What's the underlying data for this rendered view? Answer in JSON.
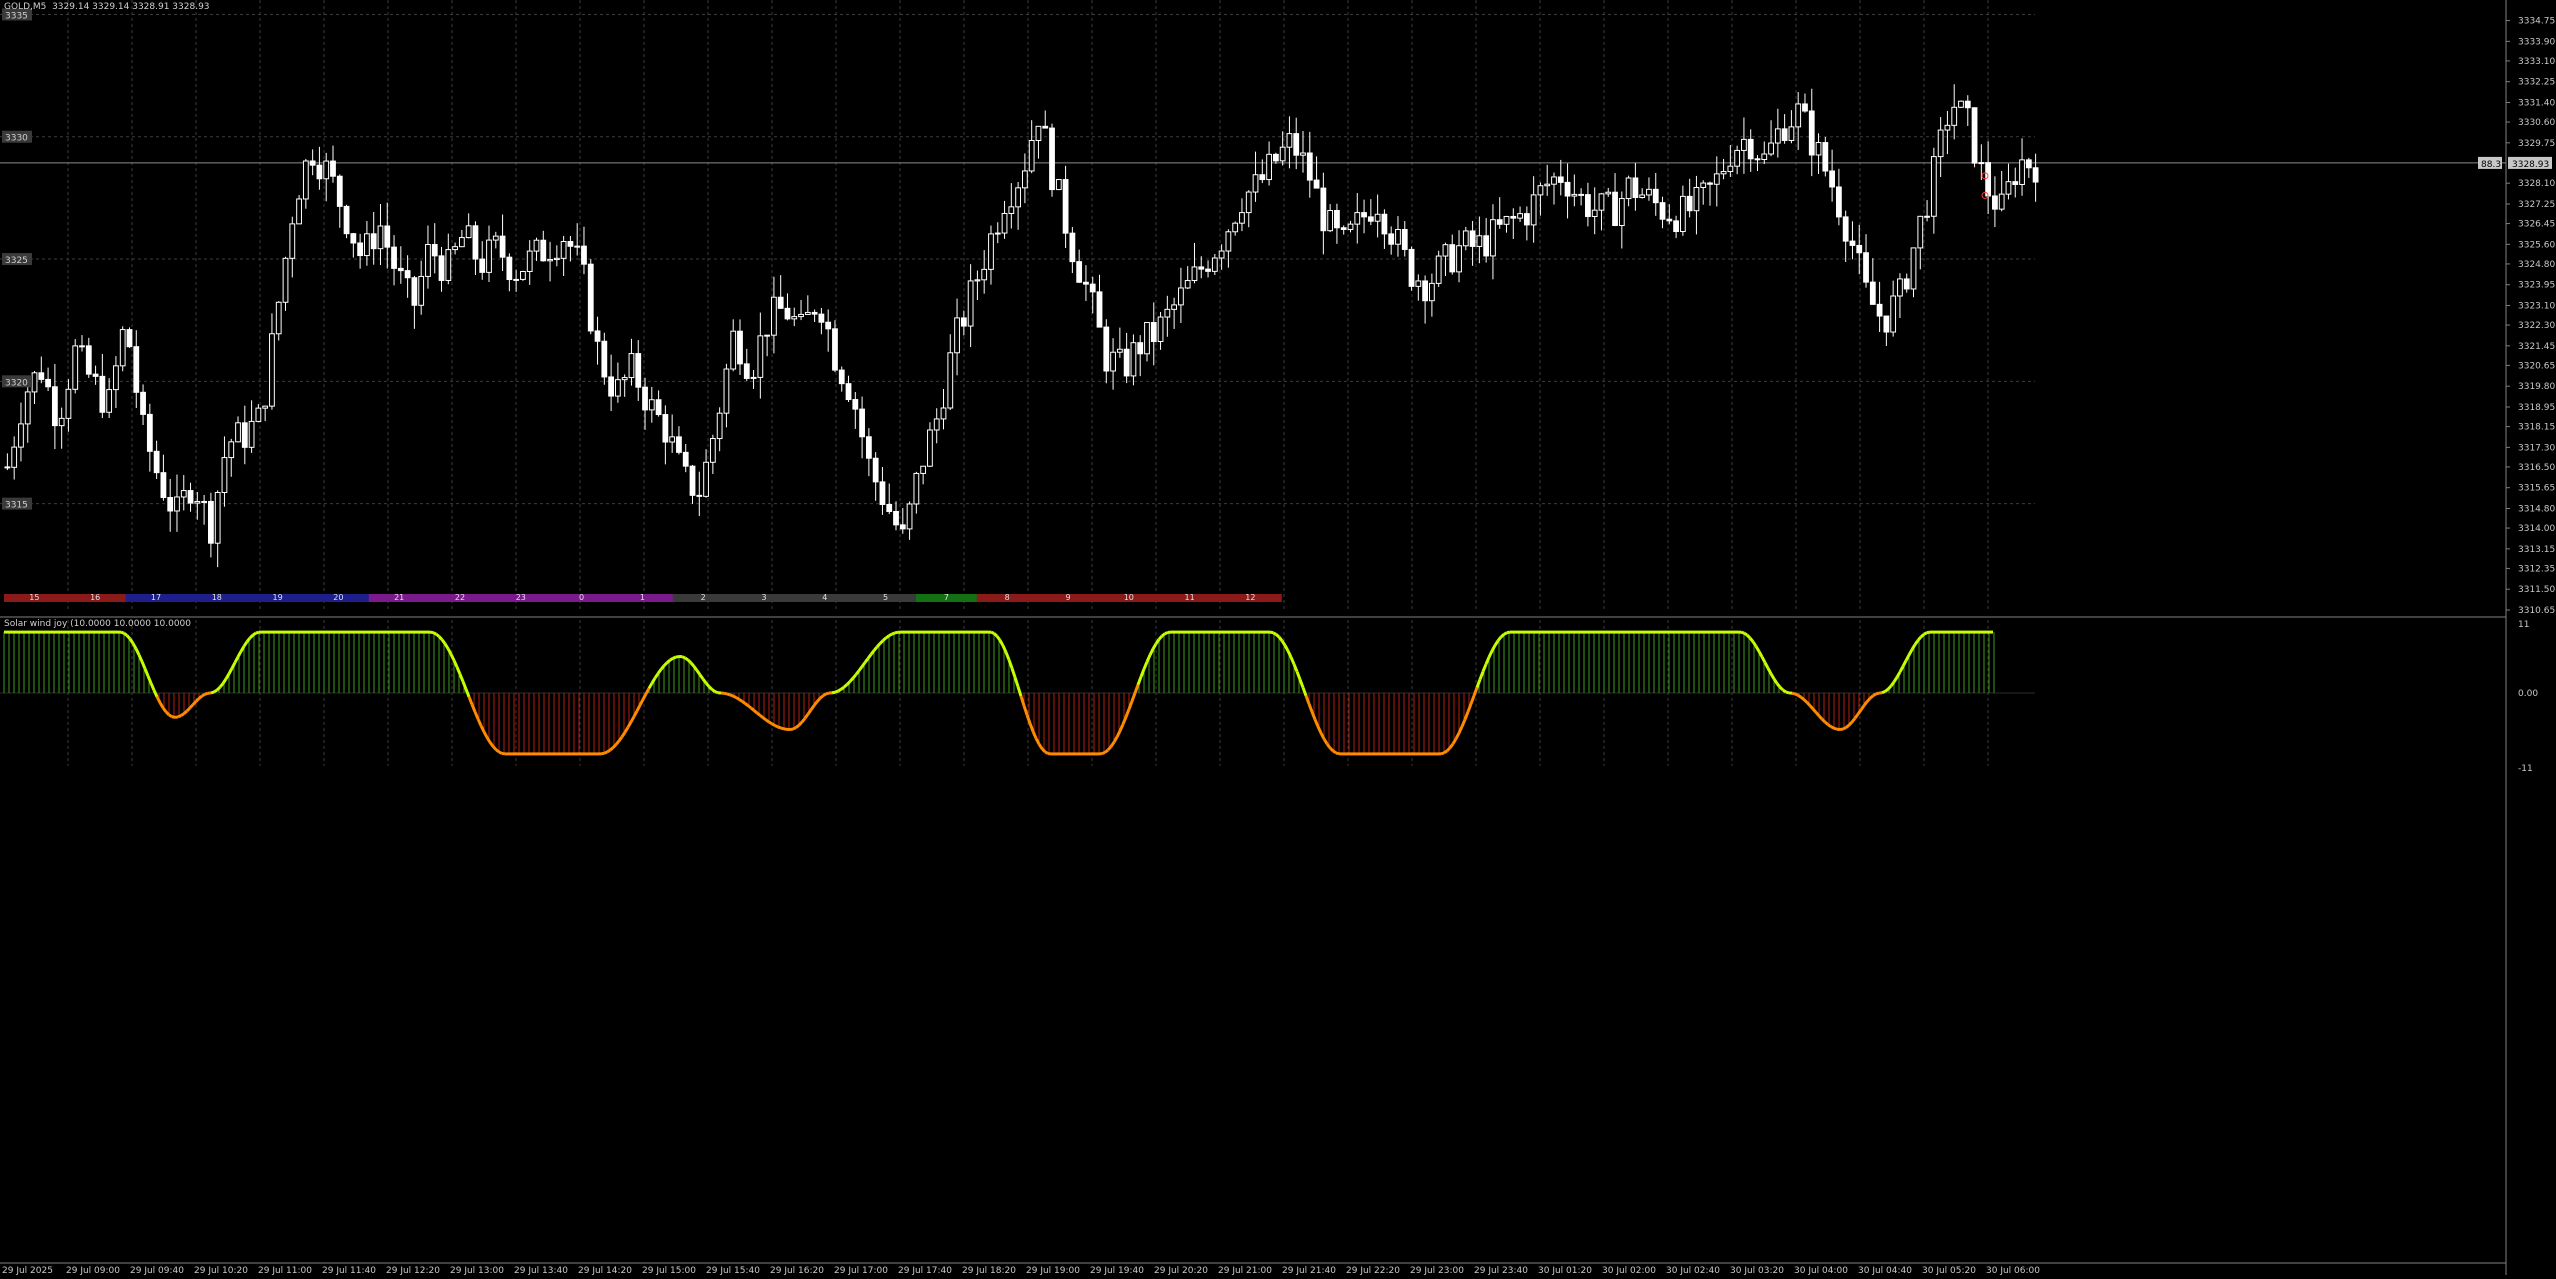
{
  "header": {
    "symbol_line": "GOLD,M5  3329.14 3329.14 3328.91 3328.93",
    "indicator_line": "Solar wind joy (10.0000 10.0000 10.0000"
  },
  "colors": {
    "background": "#000000",
    "grid": "#3c3c3c",
    "candle": "#ffffff",
    "bid_line": "#8c8c8c",
    "osc_pos": "#3a9a1e",
    "osc_neg": "#b22010",
    "osc_line_pos": "#c8ff00",
    "osc_line_neg": "#ff8c00"
  },
  "price_axis": {
    "ticks": [
      "3334.75",
      "3333.90",
      "3333.10",
      "3332.25",
      "3331.40",
      "3330.60",
      "3329.75",
      "3328.10",
      "3327.25",
      "3326.45",
      "3325.60",
      "3324.80",
      "3323.95",
      "3323.10",
      "3322.30",
      "3321.45",
      "3320.65",
      "3319.80",
      "3318.95",
      "3318.15",
      "3317.30",
      "3316.50",
      "3315.65",
      "3314.80",
      "3314.00",
      "3313.15",
      "3312.35",
      "3311.50",
      "3310.65"
    ],
    "bid_label": "3328.93",
    "bid_left_tag": "88.3"
  },
  "left_labels": [
    "3335",
    "3330",
    "3325",
    "3320",
    "3315"
  ],
  "session_bar": [
    {
      "label": "15",
      "color": "#8b1a1a"
    },
    {
      "label": "16",
      "color": "#8b1a1a"
    },
    {
      "label": "17",
      "color": "#1e1e8c"
    },
    {
      "label": "18",
      "color": "#1e1e8c"
    },
    {
      "label": "19",
      "color": "#1e1e8c"
    },
    {
      "label": "20",
      "color": "#1e1e8c"
    },
    {
      "label": "21",
      "color": "#7a1a8c"
    },
    {
      "label": "22",
      "color": "#7a1a8c"
    },
    {
      "label": "23",
      "color": "#7a1a8c"
    },
    {
      "label": "0",
      "color": "#7a1a8c"
    },
    {
      "label": "1",
      "color": "#7a1a8c"
    },
    {
      "label": "2",
      "color": "#3a3a3a"
    },
    {
      "label": "3",
      "color": "#3a3a3a"
    },
    {
      "label": "4",
      "color": "#3a3a3a"
    },
    {
      "label": "5",
      "color": "#3a3a3a"
    },
    {
      "label": "7",
      "color": "#137013"
    },
    {
      "label": "8",
      "color": "#8b1a1a"
    },
    {
      "label": "9",
      "color": "#8b1a1a"
    },
    {
      "label": "10",
      "color": "#8b1a1a"
    },
    {
      "label": "11",
      "color": "#8b1a1a"
    },
    {
      "label": "12",
      "color": "#8b1a1a"
    }
  ],
  "osc_axis": {
    "ticks": [
      "11",
      "0.00",
      "-11"
    ]
  },
  "time_axis": {
    "ticks": [
      "29 Jul 2025",
      "29 Jul 09:00",
      "29 Jul 09:40",
      "29 Jul 10:20",
      "29 Jul 11:00",
      "29 Jul 11:40",
      "29 Jul 12:20",
      "29 Jul 13:00",
      "29 Jul 13:40",
      "29 Jul 14:20",
      "29 Jul 15:00",
      "29 Jul 15:40",
      "29 Jul 16:20",
      "29 Jul 17:00",
      "29 Jul 17:40",
      "29 Jul 18:20",
      "29 Jul 19:00",
      "29 Jul 19:40",
      "29 Jul 20:20",
      "29 Jul 21:00",
      "29 Jul 21:40",
      "29 Jul 22:20",
      "29 Jul 23:00",
      "29 Jul 23:40",
      "30 Jul 01:20",
      "30 Jul 02:00",
      "30 Jul 02:40",
      "30 Jul 03:20",
      "30 Jul 04:00",
      "30 Jul 04:40",
      "30 Jul 05:20",
      "30 Jul 06:00"
    ]
  },
  "chart_data": {
    "type": "candlestick",
    "symbol": "GOLD",
    "timeframe": "M5",
    "ylim": [
      3310.65,
      3335.1
    ],
    "bid": 3328.93,
    "close_path": [
      3316.5,
      3319.5,
      3320.5,
      3318.5,
      3321.2,
      3320.0,
      3319.0,
      3322.5,
      3318.0,
      3316.0,
      3314.5,
      3316.0,
      3314.0,
      3317.5,
      3317.8,
      3318.5,
      3323.0,
      3327.5,
      3329.5,
      3328.5,
      3326.8,
      3325.0,
      3326.5,
      3324.5,
      3323.0,
      3325.5,
      3324.5,
      3326.0,
      3324.8,
      3325.5,
      3324.5,
      3325.0,
      3325.5,
      3326.0,
      3324.5,
      3321.0,
      3319.5,
      3320.5,
      3319.0,
      3318.0,
      3316.0,
      3315.5,
      3318.5,
      3322.0,
      3320.5,
      3322.5,
      3323.0,
      3322.0,
      3323.5,
      3321.0,
      3319.5,
      3316.5,
      3315.0,
      3313.5,
      3316.5,
      3318.5,
      3321.5,
      3323.5,
      3325.5,
      3327.5,
      3328.5,
      3331.0,
      3328.0,
      3325.5,
      3323.5,
      3321.0,
      3320.5,
      3321.5,
      3322.0,
      3323.0,
      3324.0,
      3325.0,
      3326.0,
      3327.5,
      3328.0,
      3329.0,
      3329.8,
      3328.5,
      3326.5,
      3325.5,
      3326.5,
      3327.5,
      3326.0,
      3324.5,
      3324.0,
      3324.8,
      3325.5,
      3325.5,
      3326.0,
      3326.5,
      3327.0,
      3328.0,
      3328.5,
      3327.5,
      3327.0,
      3327.0,
      3328.0,
      3327.5,
      3327.0,
      3326.8,
      3327.2,
      3328.0,
      3329.5,
      3330.0,
      3329.0,
      3330.5,
      3331.0,
      3329.5,
      3328.0,
      3326.0,
      3323.5,
      3322.5,
      3323.5,
      3326.0,
      3328.5,
      3331.5,
      3330.5,
      3328.0,
      3327.0,
      3329.0,
      3328.9
    ],
    "volatility": 1.1,
    "oscillator": {
      "name": "Solar wind joy",
      "ylim": [
        -11,
        11
      ],
      "points": [
        [
          0,
          10.0
        ],
        [
          0.02,
          9.9
        ],
        [
          0.035,
          7.0
        ],
        [
          0.05,
          2.0
        ],
        [
          0.065,
          -3.5
        ],
        [
          0.073,
          -4.0
        ],
        [
          0.081,
          -3.0
        ],
        [
          0.095,
          4.0
        ],
        [
          0.105,
          10.0
        ],
        [
          0.17,
          10.0
        ],
        [
          0.19,
          6.0
        ],
        [
          0.2,
          0.0
        ],
        [
          0.215,
          -7.5
        ],
        [
          0.235,
          -10.0
        ],
        [
          0.255,
          -9.9
        ],
        [
          0.27,
          -5.0
        ],
        [
          0.28,
          2.0
        ],
        [
          0.295,
          6.5
        ],
        [
          0.3,
          5.0
        ],
        [
          0.31,
          0.0
        ],
        [
          0.32,
          -3.0
        ],
        [
          0.31,
          -3.0
        ],
        [
          0.305,
          -3.0
        ],
        [
          0.318,
          -3.0
        ],
        [
          0.31,
          -3.0
        ]
      ]
    }
  }
}
